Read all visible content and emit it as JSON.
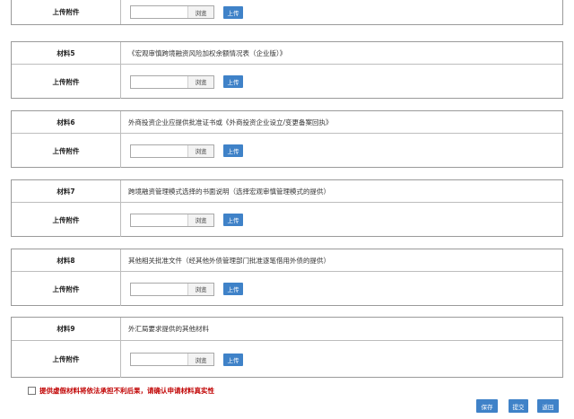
{
  "labels": {
    "upload_row": "上传附件",
    "browse": "浏览",
    "upload_button": "上传"
  },
  "materials": [
    {
      "label": "材料5",
      "description": "《宏观审慎跨境融资风险加权余额情况表（企业版）》"
    },
    {
      "label": "材料6",
      "description": "外商投资企业应提供批准证书或《外商投资企业设立/变更备案回执》"
    },
    {
      "label": "材料7",
      "description": "跨境融资管理模式选择的书面说明（选择宏观审慎管理模式的提供）"
    },
    {
      "label": "材料8",
      "description": "其他相关批准文件（经其他外债管理部门批准逐笔借用外债的提供）"
    },
    {
      "label": "材料9",
      "description": "外汇局要求提供的其他材料"
    }
  ],
  "notice": "提供虚假材料将依法承担不利后果，请确认申请材料真实性",
  "actions": {
    "save": "保存",
    "submit": "提交",
    "back": "返回"
  },
  "colors": {
    "button_blue": "#3f82c8",
    "notice_red": "#c00000",
    "border": "#9a9a9a"
  }
}
